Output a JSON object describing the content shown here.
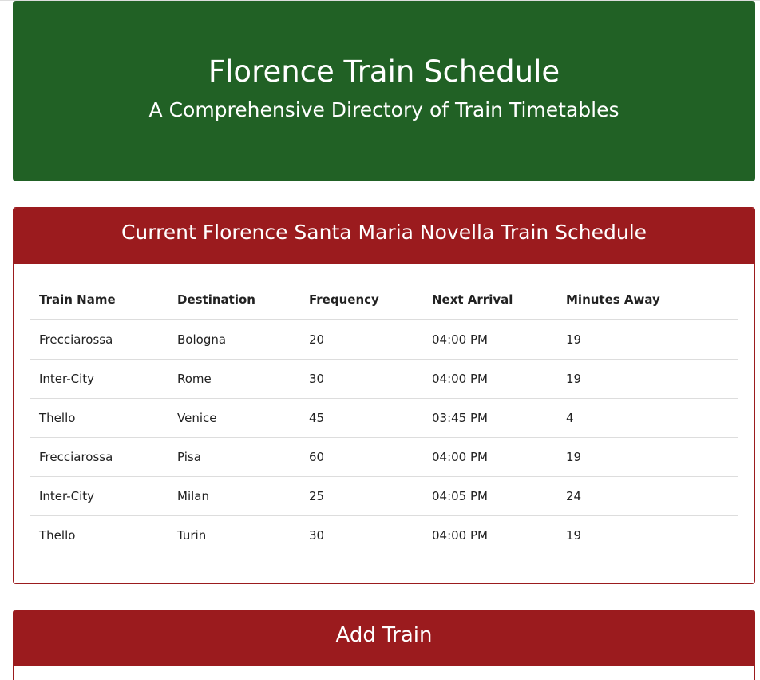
{
  "header": {
    "title": "Florence Train Schedule",
    "subtitle": "A Comprehensive Directory of Train Timetables",
    "color": "#216125"
  },
  "schedule": {
    "heading": "Current Florence Santa Maria Novella Train Schedule",
    "color": "#9b1b1e",
    "columns": [
      "Train Name",
      "Destination",
      "Frequency",
      "Next Arrival",
      "Minutes Away"
    ],
    "rows": [
      [
        "Frecciarossa",
        "Bologna",
        "20",
        "04:00 PM",
        "19"
      ],
      [
        "Inter-City",
        "Rome",
        "30",
        "04:00 PM",
        "19"
      ],
      [
        "Thello",
        "Venice",
        "45",
        "03:45 PM",
        "4"
      ],
      [
        "Frecciarossa",
        "Pisa",
        "60",
        "04:00 PM",
        "19"
      ],
      [
        "Inter-City",
        "Milan",
        "25",
        "04:05 PM",
        "24"
      ],
      [
        "Thello",
        "Turin",
        "30",
        "04:00 PM",
        "19"
      ]
    ]
  },
  "add_train": {
    "heading": "Add Train"
  }
}
